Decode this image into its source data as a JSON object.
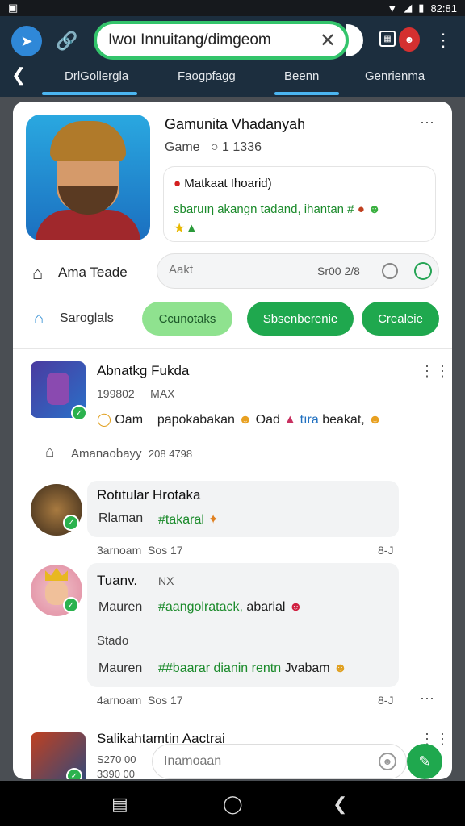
{
  "status": {
    "time": "82:81"
  },
  "browser": {
    "url_value": "Iwoı Innuitang/dimgeom",
    "tabs": [
      {
        "label": "DrlGollergla",
        "active": true
      },
      {
        "label": "Faogpfagg",
        "active": false
      },
      {
        "label": "Beenn",
        "active": true
      },
      {
        "label": "Genrienma",
        "active": false
      }
    ]
  },
  "post": {
    "title": "Gamunita Vhadanyah",
    "subtitle": "Game",
    "subtitle_count": "1 1336",
    "bubble_line1": "Matkaat Ihoarid)",
    "bubble_line2": "sbaruıη akangn tadand, ihantan #"
  },
  "actions": {
    "home_label": "Ama Teade",
    "search_placeholder": "Aakt",
    "search_count": "Sr00 2/8",
    "section_label": "Saroglals",
    "pills": [
      "Ccunotaks",
      "Sbsenberenie",
      "Crealeie"
    ]
  },
  "feed": [
    {
      "name": "Abnatkg Fukda",
      "meta1": "199802",
      "meta2": "MAX",
      "line_lead": "Oam",
      "line_text": "papokabakan",
      "line_tail": "Oad",
      "line_blue": "tıra",
      "line_end": "beakat,",
      "footer": "Amanaobayy",
      "footer_num": "208 4798"
    },
    {
      "name": "Rotıtular Hrotaka",
      "label": "Rlaman",
      "tag": "#takaral",
      "footer_left": "3arnoam",
      "footer_mid": "Sos 17",
      "footer_right": "8-J"
    },
    {
      "name": "Tuanv.",
      "badge_text": "NX",
      "label1": "Mauren",
      "tag1": "#aangolratack,",
      "tag1_end": "abarial",
      "status": "Stado",
      "label2": "Mauren",
      "tag2": "##baarar dianin rentn",
      "tag2_end": "Jvabam",
      "footer_left": "4arnoam",
      "footer_mid": "Sos 17",
      "footer_right": "8-J"
    },
    {
      "name": "Salikahtamtin Aactrai",
      "meta1": "S270 00",
      "meta2": "3390 00"
    }
  ],
  "composer": {
    "placeholder": "Inamoaan"
  },
  "colors": {
    "accent": "#1fa84e",
    "tab_underline": "#4bb5f0",
    "appbar": "#1c2e3e"
  }
}
